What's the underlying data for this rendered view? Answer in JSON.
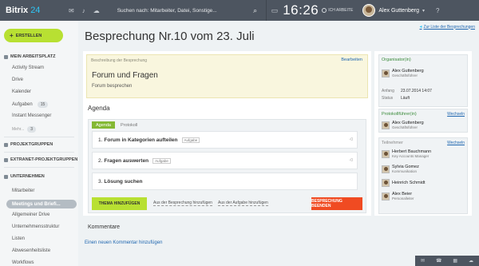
{
  "topbar": {
    "logo_brand": "Bitrix",
    "logo_num": "24",
    "search_placeholder": "Suchen nach: Mitarbeiter, Datei, Sonstige...",
    "time": "16:26",
    "work_label": "ICH ARBEITE",
    "user_name": "Alex Guttenberg"
  },
  "sidebar": {
    "create_label": "ERSTELLEN",
    "section_workspace": "MEIN ARBEITSPLATZ",
    "items": [
      {
        "label": "Activity Stream"
      },
      {
        "label": "Drive"
      },
      {
        "label": "Kalender"
      },
      {
        "label": "Aufgaben",
        "count": "15"
      },
      {
        "label": "Instant Messenger"
      }
    ],
    "more_label": "Mehr...",
    "more_count": "3",
    "section_projects": "PROJEKTGRUPPEN",
    "section_extranet": "EXTRANET-PROJEKTGRUPPEN",
    "section_company": "UNTERNEHMEN",
    "company_items": [
      {
        "label": "Mitarbeiter"
      },
      {
        "label": "Meetings und Briefi..."
      },
      {
        "label": "Allgemeiner Drive"
      },
      {
        "label": "Unternehmensstruktur"
      },
      {
        "label": "Listen"
      },
      {
        "label": "Abwesenheitsliste"
      },
      {
        "label": "Workflows"
      }
    ]
  },
  "main": {
    "title": "Besprechung Nr.10 vom 23. Juli",
    "back_link": "Zur Liste der Besprechungen",
    "description": {
      "label": "Beschreibung der Besprechung",
      "edit": "Bearbeiten",
      "title": "Forum und Fragen",
      "body": "Forum besprechen"
    },
    "agenda_title": "Agenda",
    "tabs": [
      "Agenda",
      "Protokoll"
    ],
    "agenda_items": [
      {
        "num": "1.",
        "text": "Forum in Kategorien aufteilen",
        "badge": "Aufgabe",
        "comments": "0"
      },
      {
        "num": "2.",
        "text": "Fragen auswerten",
        "badge": "Aufgabe",
        "comments": "0"
      },
      {
        "num": "3.",
        "text": "Lösung suchen",
        "badge": "",
        "comments": ""
      }
    ],
    "btn_add_topic": "THEMA HINZUFÜGEN",
    "link_from_meeting": "Aus der Besprechung hinzufügen",
    "link_from_task": "Aus der Aufgabe hinzufügen",
    "btn_end": "BESPRECHUNG BEENDEN",
    "comments_title": "Kommentare",
    "new_comment": "Einen neuen Kommentar hinzufügen"
  },
  "right": {
    "organizer_head": "Organisator(in)",
    "organizer": {
      "name": "Alex Guttenberg",
      "role": "Geschäftsführer"
    },
    "start_label": "Anfang",
    "start_value": "23.07.2014 14:07",
    "status_label": "Status",
    "status_value": "Läuft",
    "keeper_head": "Protokollführer(in)",
    "change_label": "Wechseln",
    "keeper": {
      "name": "Alex Guttenberg",
      "role": "Geschäftsführer"
    },
    "participants_head": "Teilnehmer",
    "participants": [
      {
        "name": "Herbert Bauchmann",
        "role": "Key Accounts Manager"
      },
      {
        "name": "Sylvia Gomez",
        "role": "Kommunikation"
      },
      {
        "name": "Heinrich Schmidt",
        "role": ""
      },
      {
        "name": "Alex Beier",
        "role": "Personalleiter"
      }
    ]
  }
}
